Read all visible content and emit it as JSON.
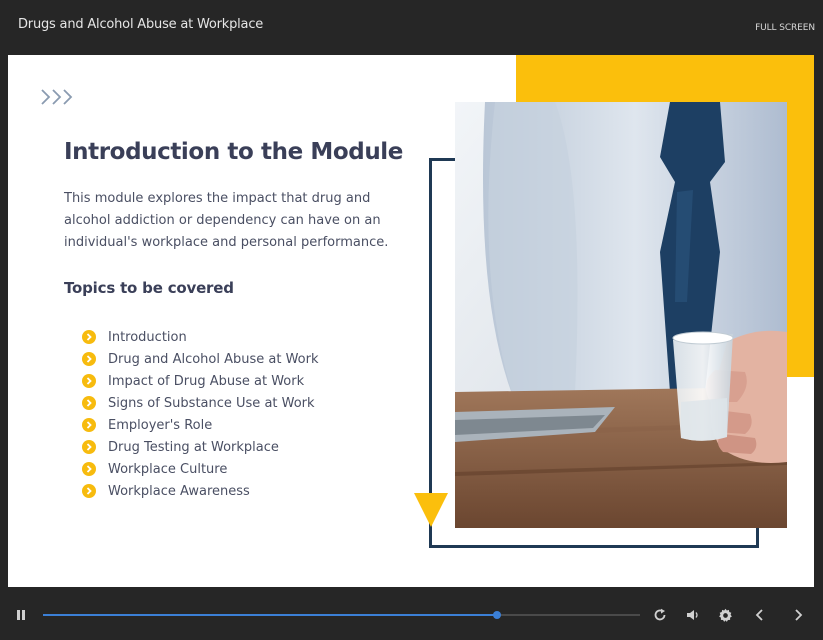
{
  "header": {
    "title": "Drugs and Alcohol Abuse at Workplace",
    "fullscreen_label": "FULL SCREEN"
  },
  "slide": {
    "title": "Introduction to the Module",
    "description": "This module explores the impact that drug and alcohol addiction or dependency can have on an individual's workplace and personal performance.",
    "topics_heading": "Topics to be covered",
    "topics": [
      "Introduction",
      "Drug and Alcohol Abuse at Work",
      "Impact of Drug Abuse at Work",
      "Signs of Substance Use at Work",
      "Employer's Role",
      "Drug Testing at Workplace",
      "Workplace Culture",
      "Workplace Awareness"
    ]
  },
  "player": {
    "progress_fraction": 0.76,
    "controls": [
      "pause-icon",
      "replay-icon",
      "volume-icon",
      "gear-icon",
      "chevron-left-icon",
      "chevron-right-icon"
    ]
  },
  "colors": {
    "accent_yellow": "#fbbf0c",
    "frame_navy": "#1f3954",
    "progress_blue": "#3b7fd6",
    "heading": "#3a3f58"
  }
}
